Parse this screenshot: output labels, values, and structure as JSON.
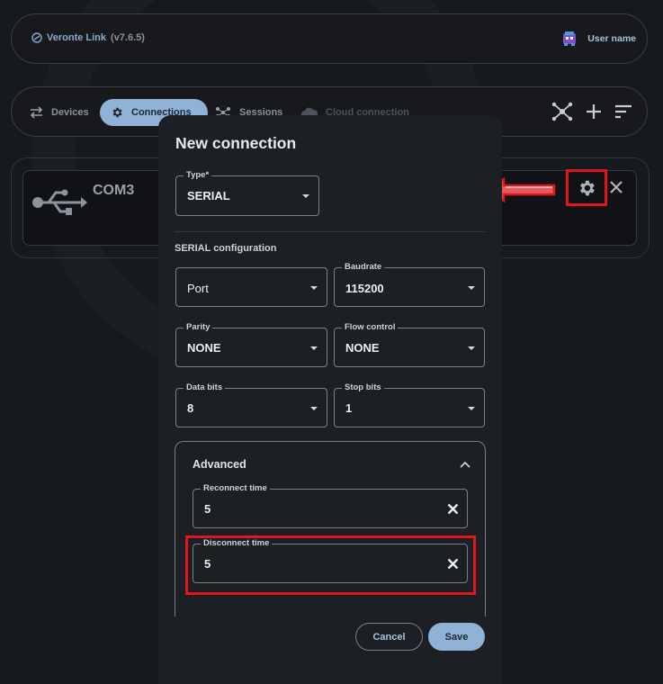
{
  "app": {
    "title": "Veronte Link",
    "version": "(v7.6.5)",
    "user_name": "User name"
  },
  "nav": {
    "tabs": [
      {
        "label": "Devices",
        "icon": "swap-arrows-icon",
        "state": "normal"
      },
      {
        "label": "Connections",
        "icon": "gear-icon",
        "state": "active"
      },
      {
        "label": "Sessions",
        "icon": "network-icon",
        "state": "normal"
      },
      {
        "label": "Cloud connection",
        "icon": "cloud-icon",
        "state": "disabled"
      }
    ],
    "actions": [
      "hub-icon",
      "add-icon",
      "sort-icon"
    ]
  },
  "connection_card": {
    "title": "COM3",
    "icon": "usb-icon"
  },
  "dialog": {
    "title": "New connection",
    "type": {
      "label": "Type*",
      "value": "SERIAL"
    },
    "section_title": "SERIAL configuration",
    "port": {
      "label": "",
      "value": "Port"
    },
    "baudrate": {
      "label": "Baudrate",
      "value": "115200"
    },
    "parity": {
      "label": "Parity",
      "value": "NONE"
    },
    "flow_control": {
      "label": "Flow control",
      "value": "NONE"
    },
    "data_bits": {
      "label": "Data bits",
      "value": "8"
    },
    "stop_bits": {
      "label": "Stop bits",
      "value": "1"
    },
    "advanced": {
      "title": "Advanced",
      "reconnect_time": {
        "label": "Reconnect time",
        "value": "5"
      },
      "disconnect_time": {
        "label": "Disconnect time",
        "value": "5"
      }
    },
    "cancel_label": "Cancel",
    "save_label": "Save"
  },
  "colors": {
    "accent": "#8fb2d6",
    "highlight": "#e0161c",
    "background": "#16191d",
    "dialog": "#1c1f24"
  }
}
